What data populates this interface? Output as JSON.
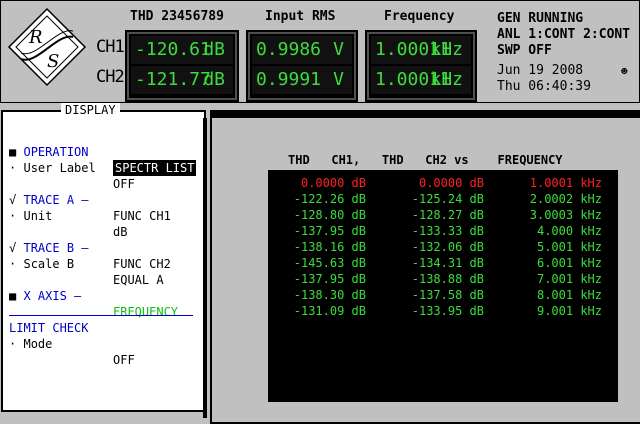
{
  "header": {
    "columns": [
      {
        "title": "THD 23456789"
      },
      {
        "title": "Input RMS"
      },
      {
        "title": "Frequency"
      }
    ],
    "channels": [
      "CH1",
      "CH2"
    ],
    "thd": [
      {
        "value": "-120.61",
        "unit": "dB"
      },
      {
        "value": "-121.77",
        "unit": "dB"
      }
    ],
    "rms": [
      {
        "value": "0.9986",
        "unit": "V"
      },
      {
        "value": "0.9991",
        "unit": "V"
      }
    ],
    "freq": [
      {
        "value": "1.00011",
        "unit": "kHz"
      },
      {
        "value": "1.00011",
        "unit": "kHz"
      }
    ],
    "status": {
      "gen": "GEN RUNNING",
      "anl": "ANL 1:CONT 2:CONT",
      "swp": "SWP OFF",
      "date": "Jun 19 2008",
      "time": "Thu 06:40:39"
    },
    "logo_letters": [
      "R",
      "S"
    ]
  },
  "display_panel": {
    "title": "DISPLAY",
    "operation": {
      "marker": "■",
      "label": "OPERATION",
      "value": "SPECTR LIST"
    },
    "user_label": {
      "marker": "·",
      "label": "User Label",
      "value": "OFF"
    },
    "trace_a": {
      "marker": "√",
      "label": "TRACE A —",
      "value": "FUNC CH1"
    },
    "trace_a_unit": {
      "marker": "·",
      "label": "Unit",
      "value": "dB"
    },
    "trace_b": {
      "marker": "√",
      "label": "TRACE B —",
      "value": "FUNC CH2"
    },
    "trace_b_scale": {
      "marker": "·",
      "label": "Scale B",
      "value": "EQUAL A"
    },
    "x_axis": {
      "marker": "■",
      "label": "X AXIS —",
      "value": "FREQUENCY"
    },
    "limit_check": {
      "label": "LIMIT CHECK"
    },
    "mode": {
      "marker": "·",
      "label": "Mode",
      "value": "OFF"
    }
  },
  "spectrum_list": {
    "header": "THD   CH1,   THD   CH2 vs    FREQUENCY",
    "rows": [
      {
        "ch1": "0.0000 dB",
        "ch2": "0.0000 dB",
        "freq": "1.0001 kHz",
        "reference": true
      },
      {
        "ch1": "-122.26 dB",
        "ch2": "-125.24 dB",
        "freq": "2.0002 kHz"
      },
      {
        "ch1": "-128.80 dB",
        "ch2": "-128.27 dB",
        "freq": "3.0003 kHz"
      },
      {
        "ch1": "-137.95 dB",
        "ch2": "-133.33 dB",
        "freq": "4.000 kHz"
      },
      {
        "ch1": "-138.16 dB",
        "ch2": "-132.06 dB",
        "freq": "5.001 kHz"
      },
      {
        "ch1": "-145.63 dB",
        "ch2": "-134.31 dB",
        "freq": "6.001 kHz"
      },
      {
        "ch1": "-137.95 dB",
        "ch2": "-138.88 dB",
        "freq": "7.001 kHz"
      },
      {
        "ch1": "-138.30 dB",
        "ch2": "-137.58 dB",
        "freq": "8.001 kHz"
      },
      {
        "ch1": "-131.09 dB",
        "ch2": "-133.95 dB",
        "freq": "9.001 kHz"
      }
    ]
  },
  "colors": {
    "readout_green": "#3cdc3c",
    "reference_red": "#ff2020",
    "menu_blue": "#0000c8",
    "xaxis_green": "#10c010",
    "panel_gray": "#c0c0c0"
  }
}
